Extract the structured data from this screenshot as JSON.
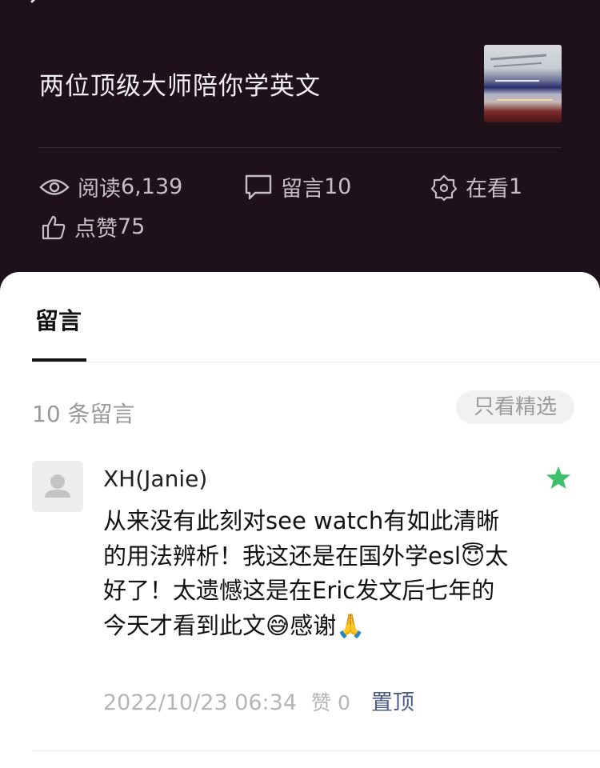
{
  "article": {
    "title": "两位顶级大师陪你学英文"
  },
  "stats": {
    "read_label": "阅读",
    "read_value": "6,139",
    "comment_label": "留言",
    "comment_value": "10",
    "watch_label": "在看",
    "watch_value": "1",
    "like_label": "点赞",
    "like_value": "75"
  },
  "sheet": {
    "tab_label": "留言",
    "count_text": "10 条留言",
    "filter_label": "只看精选"
  },
  "comment": {
    "author": "XH(Janie)",
    "text": "从来没有此刻对see watch有如此清晰的用法辨析！我这还是在国外学esl😇太好了！太遗憾这是在Eric发文后七年的今天才看到此文😅感谢🙏",
    "timestamp": "2022/10/23 06:34",
    "likes": "赞 0",
    "pin_label": "置顶"
  },
  "colors": {
    "background": "#1e111a",
    "star": "#3ec16d",
    "link": "#4b5c8a"
  },
  "icons": [
    "back-icon",
    "eye-icon",
    "comment-bubble-icon",
    "watch-flower-icon",
    "thumbs-up-icon",
    "avatar-placeholder-icon",
    "star-icon"
  ]
}
